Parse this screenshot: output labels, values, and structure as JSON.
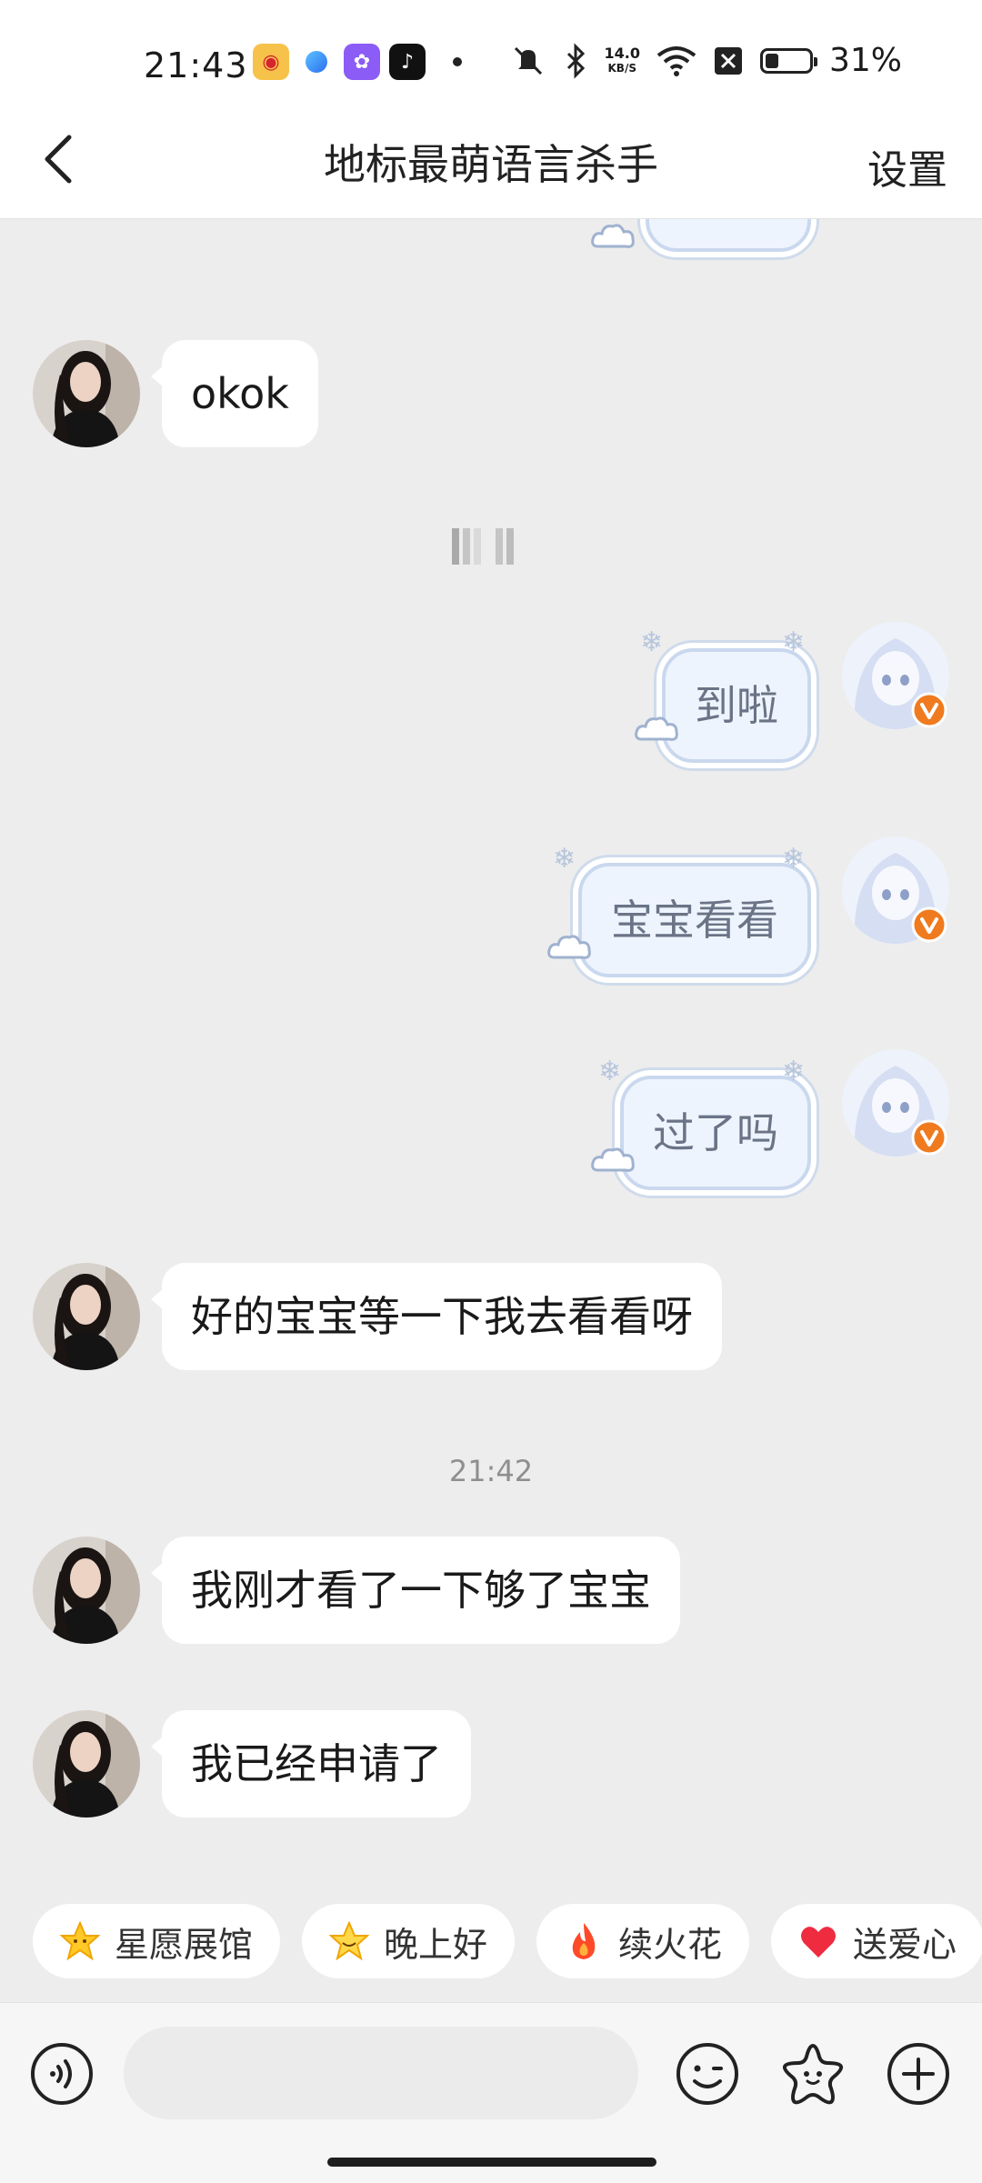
{
  "status_bar": {
    "time": "21:43",
    "net_speed_value": "14.0",
    "net_speed_unit": "KB/S",
    "battery_percent_label": "31%",
    "battery_level": 0.31
  },
  "header": {
    "title": "地标最萌语言杀手",
    "settings_label": "设置"
  },
  "messages": [
    {
      "side": "right",
      "text": ""
    },
    {
      "side": "left",
      "text": "okok"
    },
    {
      "side": "right",
      "text": "到啦"
    },
    {
      "side": "right",
      "text": "宝宝看看"
    },
    {
      "side": "right",
      "text": "过了吗"
    },
    {
      "side": "left",
      "text": "好的宝宝等一下我去看看呀"
    },
    {
      "side": "left",
      "text": "我刚才看了一下够了宝宝"
    },
    {
      "side": "left",
      "text": "我已经申请了"
    }
  ],
  "timestamp": "21:42",
  "quick_replies": [
    {
      "label": "星愿展馆",
      "icon": "star-face-icon"
    },
    {
      "label": "晚上好",
      "icon": "star-smile-icon"
    },
    {
      "label": "续火花",
      "icon": "fire-icon"
    },
    {
      "label": "送爱心",
      "icon": "heart-icon"
    }
  ],
  "input": {
    "placeholder": ""
  },
  "colors": {
    "background": "#ededed",
    "bubble_left": "#ffffff",
    "bubble_right": "#eef4fd",
    "badge_orange": "#f07a1e"
  }
}
